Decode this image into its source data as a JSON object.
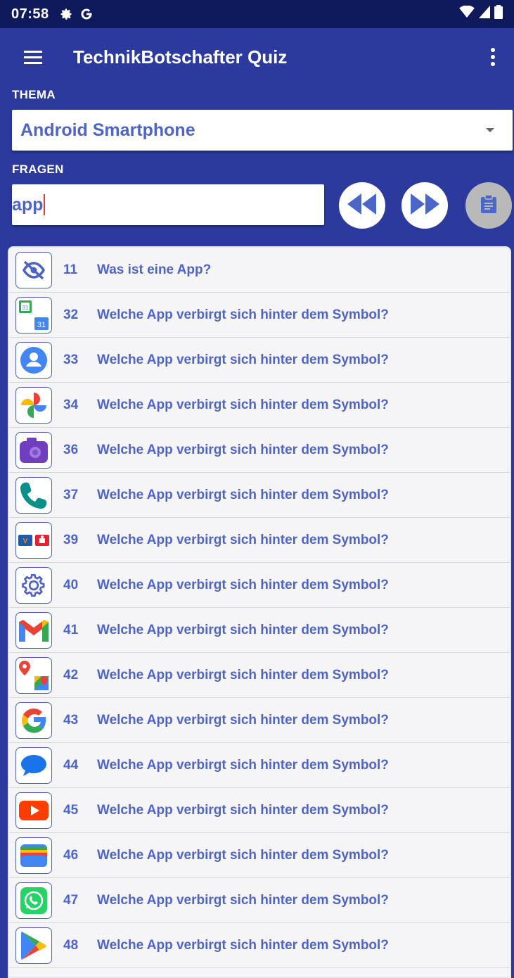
{
  "status_bar": {
    "time": "07:58",
    "icons": [
      "settings-gear-icon",
      "google-g-icon",
      "wifi-icon",
      "signal-icon",
      "battery-icon"
    ]
  },
  "app_bar": {
    "title": "TechnikBotschafter Quiz",
    "menu_icon": "hamburger-menu-icon",
    "more_icon": "more-vert-icon"
  },
  "thema": {
    "label": "THEMA",
    "selected": "Android Smartphone"
  },
  "fragen": {
    "label": "FRAGEN",
    "search_value": "app"
  },
  "buttons": {
    "previous": "rewind-icon",
    "next": "fast-forward-icon",
    "clipboard": "clipboard-icon"
  },
  "colors": {
    "primary": "#2b3a9c",
    "status_bar": "#0f1a5c",
    "accent_text": "#4e64c8",
    "cursor": "#e53935"
  },
  "questions": [
    {
      "num": "11",
      "text": "Was ist eine App?",
      "icon": "eye-off-icon"
    },
    {
      "num": "32",
      "text": "Welche App verbirgt sich hinter dem Symbol?",
      "icon": "calendar-icon"
    },
    {
      "num": "33",
      "text": "Welche App verbirgt sich hinter dem Symbol?",
      "icon": "contacts-icon"
    },
    {
      "num": "34",
      "text": "Welche App verbirgt sich hinter dem Symbol?",
      "icon": "google-photos-icon"
    },
    {
      "num": "36",
      "text": "Welche App verbirgt sich hinter dem Symbol?",
      "icon": "camera-icon"
    },
    {
      "num": "37",
      "text": "Welche App verbirgt sich hinter dem Symbol?",
      "icon": "phone-icon"
    },
    {
      "num": "39",
      "text": "Welche App verbirgt sich hinter dem Symbol?",
      "icon": "banking-icon"
    },
    {
      "num": "40",
      "text": "Welche App verbirgt sich hinter dem Symbol?",
      "icon": "settings-icon"
    },
    {
      "num": "41",
      "text": "Welche App verbirgt sich hinter dem Symbol?",
      "icon": "gmail-icon"
    },
    {
      "num": "42",
      "text": "Welche App verbirgt sich hinter dem Symbol?",
      "icon": "google-maps-icon"
    },
    {
      "num": "43",
      "text": "Welche App verbirgt sich hinter dem Symbol?",
      "icon": "google-icon"
    },
    {
      "num": "44",
      "text": "Welche App verbirgt sich hinter dem Symbol?",
      "icon": "messages-icon"
    },
    {
      "num": "45",
      "text": "Welche App verbirgt sich hinter dem Symbol?",
      "icon": "youtube-icon"
    },
    {
      "num": "46",
      "text": "Welche App verbirgt sich hinter dem Symbol?",
      "icon": "google-wallet-icon"
    },
    {
      "num": "47",
      "text": "Welche App verbirgt sich hinter dem Symbol?",
      "icon": "whatsapp-icon"
    },
    {
      "num": "48",
      "text": "Welche App verbirgt sich hinter dem Symbol?",
      "icon": "play-store-icon"
    }
  ]
}
